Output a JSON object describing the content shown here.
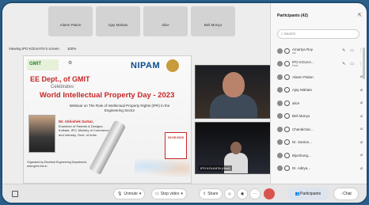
{
  "top_strip": [
    {
      "label": "Alaem Paiton"
    },
    {
      "label": "Ajay Mahato"
    },
    {
      "label": "alice"
    },
    {
      "label": "Beli Monyu"
    }
  ],
  "viewing_text": "Viewing IPO KOLKATA's screen",
  "zoom": "100%",
  "slide": {
    "gmit": "GMIT",
    "nipam_text": "NIPAM",
    "line1": "EE Dept., of GMIT",
    "line2": "Celebrates",
    "line3": "World Intellectual Property Day - 2023",
    "line4": "Webinar on The Role of Intellectual Property Rights (IPR) in the Engineering Sector",
    "speaker_name": "Mr. Abhishek Sarkar,",
    "speaker_lines": "Examiner of Patents & Designs, Kolkata, IPO, Ministry of Commerce and Industry, Govt. of India",
    "organized_by": "Organized by Electrical Engineering Department, www.gmit.edu.in",
    "date": "03.05.2023"
  },
  "videos": [
    {
      "name": ""
    },
    {
      "name": "IPO KOLKATA (Host)"
    }
  ],
  "toolbar": {
    "unmute": "Unmute",
    "stop_video": "Stop video",
    "share": "Share",
    "participants": "Participants",
    "chat": "Chat"
  },
  "panel": {
    "title": "Participants (42)",
    "search_placeholder": "Search",
    "participants": [
      {
        "name": "Amartya Roy",
        "sub": "me",
        "role": "A"
      },
      {
        "name": "IPO KOLKA...",
        "sub": "Host",
        "role": "I"
      },
      {
        "name": "Alaem Paiton",
        "sub": "",
        "role": "A"
      },
      {
        "name": "Ajay Mahato",
        "sub": "",
        "role": "A"
      },
      {
        "name": "alice",
        "sub": "",
        "role": "A"
      },
      {
        "name": "Beli Monyu",
        "sub": "",
        "role": "B"
      },
      {
        "name": "Chandichar...",
        "sub": "",
        "role": "C"
      },
      {
        "name": "Dr. Santos...",
        "sub": "",
        "role": "D"
      },
      {
        "name": "Bijonhung...",
        "sub": "",
        "role": "B"
      },
      {
        "name": "Dr. Aditya...",
        "sub": "",
        "role": "D"
      }
    ]
  }
}
